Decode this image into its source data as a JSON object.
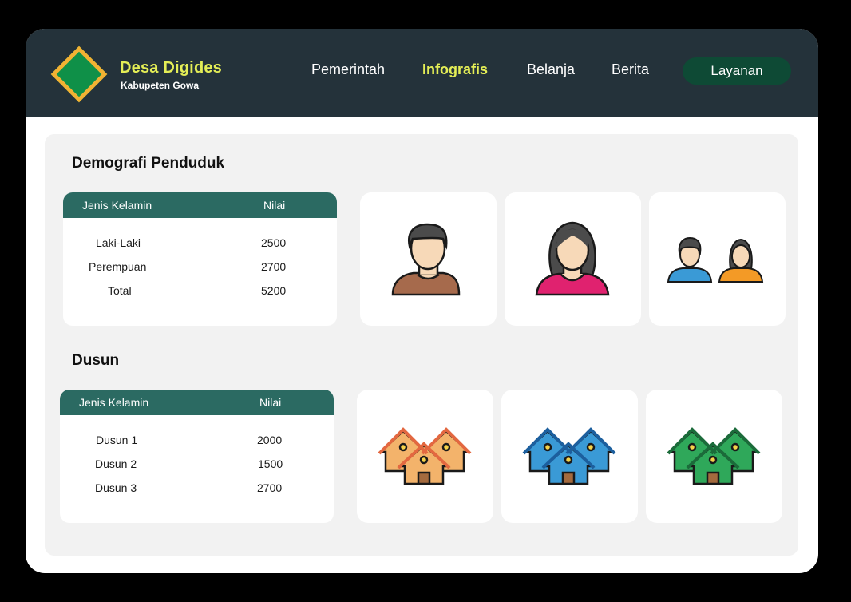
{
  "app": {
    "brand_title": "Desa Digides",
    "brand_subtitle": "Kabupeten Gowa"
  },
  "nav": {
    "items": [
      "Pemerintah",
      "Infografis",
      "Belanja",
      "Berita"
    ],
    "active": "Infografis",
    "button_label": "Layanan"
  },
  "demografi": {
    "title": "Demografi Penduduk",
    "headers": [
      "Jenis Kelamin",
      "Nilai"
    ],
    "rows": [
      {
        "label": "Laki-Laki",
        "value": "2500"
      },
      {
        "label": "Perempuan",
        "value": "2700"
      },
      {
        "label": "Total",
        "value": "5200"
      }
    ],
    "icons": [
      "man-icon",
      "woman-icon",
      "couple-icon"
    ]
  },
  "dusun": {
    "title": "Dusun",
    "headers": [
      "Jenis Kelamin",
      "Nilai"
    ],
    "rows": [
      {
        "label": "Dusun 1",
        "value": "2000"
      },
      {
        "label": "Dusun 2",
        "value": "1500"
      },
      {
        "label": "Dusun 3",
        "value": "2700"
      }
    ],
    "icons": [
      "houses-orange-icon",
      "houses-blue-icon",
      "houses-green-icon"
    ]
  },
  "colors": {
    "header_bg": "#24323a",
    "accent_yellow": "#e4ee56",
    "button_green": "#0e4a35",
    "table_head": "#2b6a62"
  }
}
